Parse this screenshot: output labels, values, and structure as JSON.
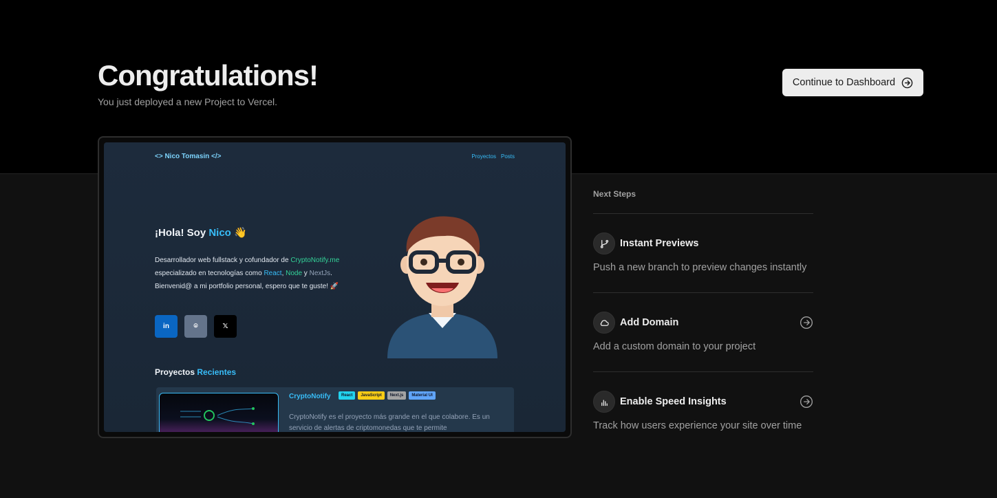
{
  "hero": {
    "title": "Congratulations!",
    "subtitle": "You just deployed a new Project to Vercel.",
    "continue_label": "Continue to Dashboard",
    "continue_icon": "arrow-right-circle-icon"
  },
  "preview": {
    "brand": "<> Nico Tomasin </>",
    "nav": [
      "Proyectos",
      "Posts"
    ],
    "greeting_prefix": "¡Hola! Soy ",
    "greeting_name": "Nico",
    "greeting_emoji": " 👋",
    "desc": {
      "p1": "Desarrollador web fullstack y cofundador de ",
      "link1": "CryptoNotify.me",
      "p2": " especializado en tecnologías como ",
      "react": "React",
      "sep": ", ",
      "node": "Node",
      "and": " y ",
      "next": "NextJs",
      "p3": ". Bienvenid@ a mi portfolio personal, espero que te guste! 🚀"
    },
    "socials": [
      "in",
      "⌾",
      "𝕏"
    ],
    "section_prefix": "Proyectos ",
    "section_accent": "Recientes",
    "project": {
      "title": "CryptoNotify",
      "tags": [
        {
          "label": "React",
          "color": "#22d3ee"
        },
        {
          "label": "JavaScript",
          "color": "#facc15"
        },
        {
          "label": "Next.js",
          "color": "#a3a3a3"
        },
        {
          "label": "Material UI",
          "color": "#60a5fa"
        }
      ],
      "text": "CryptoNotify es el proyecto más grande en el que colabore. Es un servicio de alertas de criptomonedas que te permite"
    }
  },
  "next_steps": {
    "heading": "Next Steps",
    "items": [
      {
        "title": "Instant Previews",
        "desc": "Push a new branch to preview changes instantly",
        "icon": "git-branch-icon",
        "has_arrow": false
      },
      {
        "title": "Add Domain",
        "desc": "Add a custom domain to your project",
        "icon": "cloud-icon",
        "has_arrow": true
      },
      {
        "title": "Enable Speed Insights",
        "desc": "Track how users experience your site over time",
        "icon": "bar-chart-icon",
        "has_arrow": true
      }
    ]
  },
  "colors": {
    "background": "#111111",
    "top_band": "#000000",
    "button_bg": "#ededed",
    "accent_blue": "#38bdf8"
  }
}
